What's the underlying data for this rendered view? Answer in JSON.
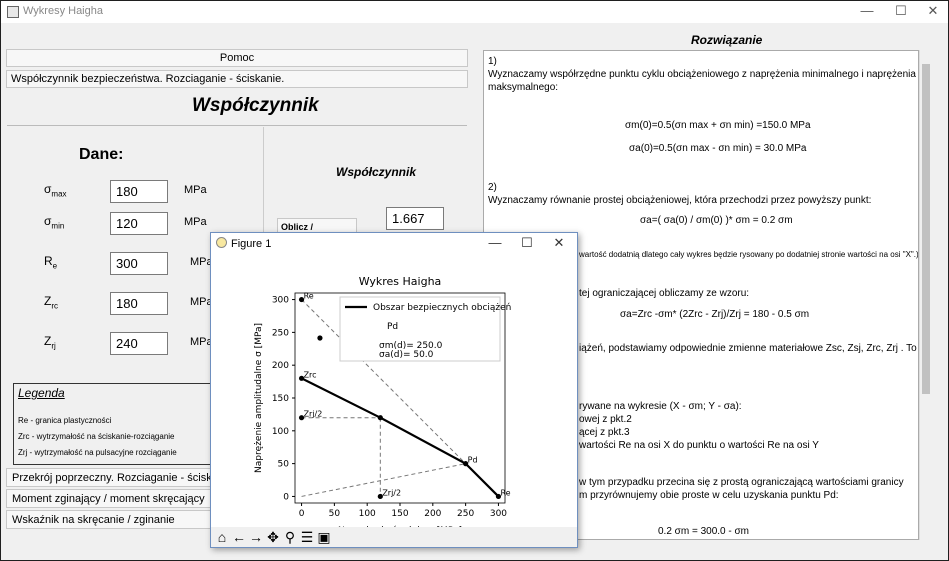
{
  "window": {
    "title": "Wykresy Haigha"
  },
  "left": {
    "help_button": "Pomoc",
    "section_header": "Współczynnik bezpieczeństwa. Rozciaganie - ściskanie.",
    "heading": "Współczynnik",
    "dane_label": "Dane:",
    "fields": [
      {
        "symbol": "σ",
        "sub": "max",
        "value": "180",
        "unit": "MPa"
      },
      {
        "symbol": "σ",
        "sub": "min",
        "value": "120",
        "unit": "MPa"
      },
      {
        "symbol": "R",
        "sub": "e",
        "value": "300",
        "unit": "MPa"
      },
      {
        "symbol": "Z",
        "sub": "rc",
        "value": "180",
        "unit": "MPa"
      },
      {
        "symbol": "Z",
        "sub": "rj",
        "value": "240",
        "unit": "MPa"
      }
    ],
    "coef_label": "Współczynnik",
    "coef_value": "1.667",
    "calc_button": "Oblicz / Rozwiązanie",
    "legend": {
      "title": "Legenda",
      "items": [
        "Re - granica plastyczności",
        "Zrc - wytrzymałość na ściskanie-rozciąganie",
        "Zrj - wytrzymałość na pulsacyjne rozciąganie"
      ]
    },
    "sections": [
      "Przekrój poprzeczny.  Rozciaganie - ściskanie.",
      "Moment zginający / moment skręcający",
      "Wskaźnik na skręcanie / zginanie"
    ]
  },
  "right": {
    "title": "Rozwiązanie",
    "lines": [
      "1)",
      "Wyznaczamy współrzędne punktu cyklu obciążeniowego z naprężenia minimalnego i naprężenia",
      "maksymalnego:",
      "σm(0)=0.5(σn max + σn min) =150.0 MPa",
      "σa(0)=0.5(σn max - σn min) = 30.0 MPa",
      "2)",
      "Wyznaczamy równanie prostej obciążeniowej, która przechodzi przez powyższy punkt:",
      "σa=( σa(0) / σm(0) )* σm = 0.2 σm",
      "wartość dodatnią dlatego cały wykres będzie rysowany po dodatniej stronie wartości na osi \"X\".)",
      "tej ograniczającej obliczamy ze wzoru:",
      "σa=Zrc -σm* (2Zrc - Zrj)/Zrj = 180 - 0.5 σm",
      "iążeń, podstawiamy odpowiednie zmienne materiałowe Zsc, Zsj, Zrc, Zrj . To samo dotyczy",
      "rywane na wykresie (X - σm; Y - σa):",
      "owej z pkt.2",
      "ącej z pkt.3",
      "wartości Re na osi X do punktu o wartości Re na osi Y",
      "w tym przypadku przecina się z prostą ograniczającą wartościami granicy",
      "m przyrównujemy obie proste w celu uzyskania punktu Pd:",
      "0.2 σm = 300.0 -  σm"
    ]
  },
  "figure": {
    "window_title": "Figure 1",
    "toolbar": [
      "home-icon",
      "back-icon",
      "forward-icon",
      "pan-icon",
      "zoom-icon",
      "configure-icon",
      "save-icon"
    ]
  },
  "chart_data": {
    "type": "line",
    "title": "Wykres Haigha",
    "xlabel": "Naprężenie średnie σ [MPa]",
    "ylabel": "Naprężenie amplitudalne σ [MPa]",
    "xlim": [
      -10,
      310
    ],
    "ylim": [
      -10,
      310
    ],
    "xticks": [
      0,
      50,
      100,
      150,
      200,
      250,
      300
    ],
    "yticks": [
      0,
      50,
      100,
      150,
      200,
      250,
      300
    ],
    "safe_area": {
      "name": "Obszar bezpiecznych obciążeń",
      "x": [
        0,
        120,
        250,
        300
      ],
      "y": [
        180,
        120,
        50,
        0
      ]
    },
    "points": [
      {
        "label": "Re",
        "x": 0,
        "y": 300
      },
      {
        "label": "Zrc",
        "x": 0,
        "y": 180
      },
      {
        "label": "Zrj/2",
        "x": 0,
        "y": 120
      },
      {
        "label": "",
        "x": 120,
        "y": 120
      },
      {
        "label": "Zrj/2",
        "x": 120,
        "y": 0
      },
      {
        "label": "Pd",
        "x": 250,
        "y": 50
      },
      {
        "label": "Re",
        "x": 300,
        "y": 0
      }
    ],
    "legend": {
      "line": "Obszar bezpiecznych obciążeń",
      "point": "Pd",
      "text": [
        "σm(d)= 250.0",
        "σa(d)= 50.0"
      ]
    }
  }
}
